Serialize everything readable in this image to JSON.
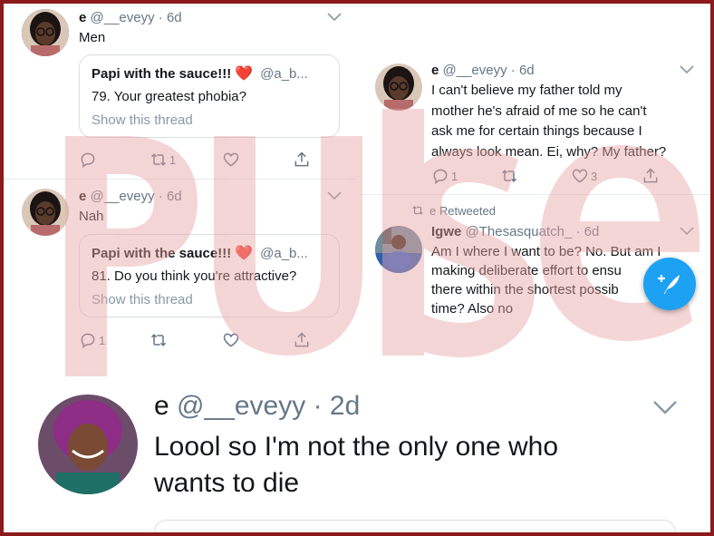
{
  "tweet1": {
    "name": "e",
    "handle": "@__eveyy",
    "time": "6d",
    "text": "Men",
    "quote": {
      "name": "Papi with the sauce!!!",
      "heart": "❤️",
      "handle": "@a_b...",
      "text": "79. Your greatest phobia?",
      "link": "Show this thread"
    },
    "actions": {
      "reply_count": "",
      "retweet_count": "1",
      "like_count": ""
    },
    "icons": [
      "reply-icon",
      "retweet-icon",
      "like-icon",
      "share-icon"
    ]
  },
  "tweet2": {
    "name": "e",
    "handle": "@__eveyy",
    "time": "6d",
    "text": "Nah",
    "quote": {
      "name": "Papi with the sauce!!!",
      "heart": "❤️",
      "handle": "@a_b...",
      "text": "81. Do you think you're attractive?",
      "link": "Show this thread"
    },
    "actions": {
      "reply_count": "1",
      "retweet_count": "",
      "like_count": ""
    }
  },
  "tweet3": {
    "name": "e",
    "handle": "@__eveyy",
    "time": "6d",
    "lines": [
      "I can't believe my father told my",
      "mother he's afraid of me so he can't",
      "ask me for certain things because I",
      "always look mean. Ei, why? My father?"
    ],
    "actions": {
      "reply_count": "1",
      "retweet_count": "",
      "like_count": "3"
    }
  },
  "tweet4": {
    "retweeted_label": "e Retweeted",
    "name": "Igwe",
    "handle": "@Thesasquatch_",
    "time": "6d",
    "lines": [
      "Am I where I want to be? No. But am I",
      "making deliberate effort to ensu",
      "there within the shortest possib",
      "time? Also no"
    ]
  },
  "tweet5": {
    "name": "e",
    "handle": "@__eveyy",
    "time": "2d",
    "lines": [
      "Loool so I'm not the only one who",
      "wants to die"
    ]
  },
  "watermark_text": "pulse",
  "colors": {
    "accent": "#1da1f2",
    "like": "#e0245e",
    "frame": "#8b1a1a",
    "watermark": "#e8a3a3",
    "muted": "#657786"
  }
}
